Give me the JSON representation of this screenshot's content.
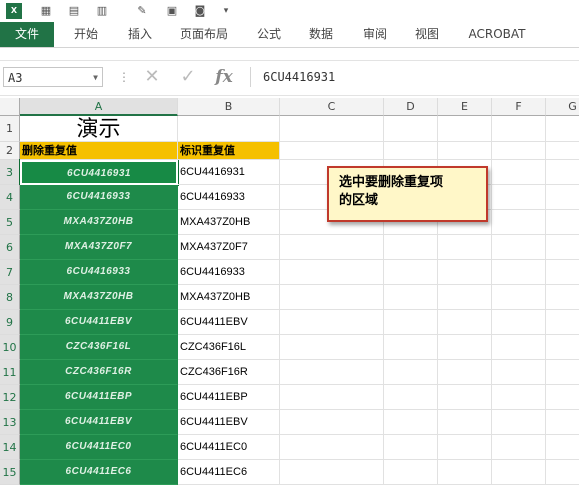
{
  "qat": {
    "icons": [
      "excel-logo-icon",
      "calendar-icon",
      "paste-icon",
      "format-icon",
      "eraser-icon",
      "picture-icon",
      "camera-icon",
      "qat-dropdown-icon"
    ]
  },
  "ribbon": {
    "tabs": [
      "文件",
      "开始",
      "插入",
      "页面布局",
      "公式",
      "数据",
      "审阅",
      "视图",
      "ACROBAT"
    ]
  },
  "formula_bar": {
    "name_box": "A3",
    "formula": "6CU4416931",
    "cancel": "✕",
    "enter": "✓",
    "fx": "fx"
  },
  "columns": [
    "A",
    "B",
    "C",
    "D",
    "E",
    "F",
    "G"
  ],
  "rows": [
    "1",
    "2",
    "3",
    "4",
    "5",
    "6",
    "7",
    "8",
    "9",
    "10",
    "11",
    "12",
    "13",
    "14",
    "15"
  ],
  "sheet": {
    "title": "演示",
    "header_a": "删除重复值",
    "header_b": "标识重复值",
    "col_a": [
      "6CU4416931",
      "6CU4416933",
      "MXA437Z0HB",
      "MXA437Z0F7",
      "6CU4416933",
      "MXA437Z0HB",
      "6CU4411EBV",
      "CZC436F16L",
      "CZC436F16R",
      "6CU4411EBP",
      "6CU4411EBV",
      "6CU4411EC0",
      "6CU4411EC6"
    ],
    "col_b": [
      "6CU4416931",
      "6CU4416933",
      "MXA437Z0HB",
      "MXA437Z0F7",
      "6CU4416933",
      "MXA437Z0HB",
      "6CU4411EBV",
      "CZC436F16L",
      "CZC436F16R",
      "6CU4411EBP",
      "6CU4411EBV",
      "6CU4411EC0",
      "6CU4411EC6"
    ]
  },
  "callout": {
    "line1": "选中要删除重复项",
    "line2": "的区域"
  },
  "colors": {
    "excel_green": "#217346",
    "selection_green": "#1e8a4a",
    "header_yellow": "#f5c000",
    "callout_border": "#c0392b"
  }
}
